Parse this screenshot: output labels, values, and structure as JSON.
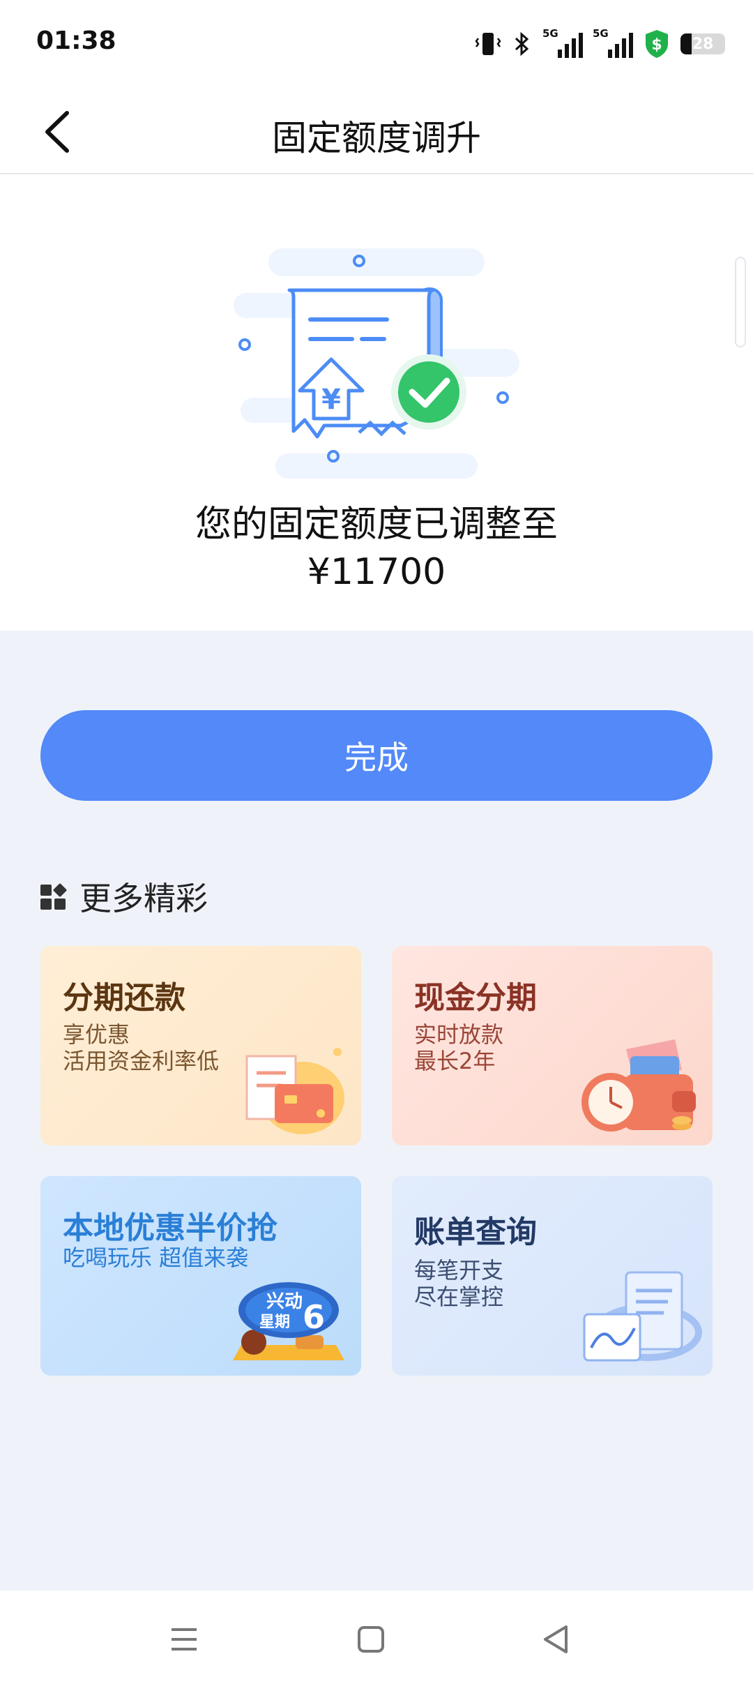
{
  "status_bar": {
    "time": "01:38",
    "signal_labels": [
      "5G",
      "5G"
    ],
    "battery": "28"
  },
  "header": {
    "title": "固定额度调升"
  },
  "result": {
    "message": "您的固定额度已调整至",
    "amount": "¥11700"
  },
  "done_button": "完成",
  "more": {
    "title": "更多精彩",
    "cards": [
      {
        "title": "分期还款",
        "lines": [
          "享优惠",
          "活用资金利率低"
        ]
      },
      {
        "title": "现金分期",
        "lines": [
          "实时放款",
          "最长2年"
        ]
      },
      {
        "title": "本地优惠半价抢",
        "lines": [
          "吃喝玩乐 超值来袭"
        ],
        "badge_text": "兴动星期6"
      },
      {
        "title": "账单查询",
        "lines": [
          "每笔开支",
          "尽在掌控"
        ]
      }
    ]
  },
  "colors": {
    "primary": "#5389f8",
    "background": "#eff3f9"
  }
}
